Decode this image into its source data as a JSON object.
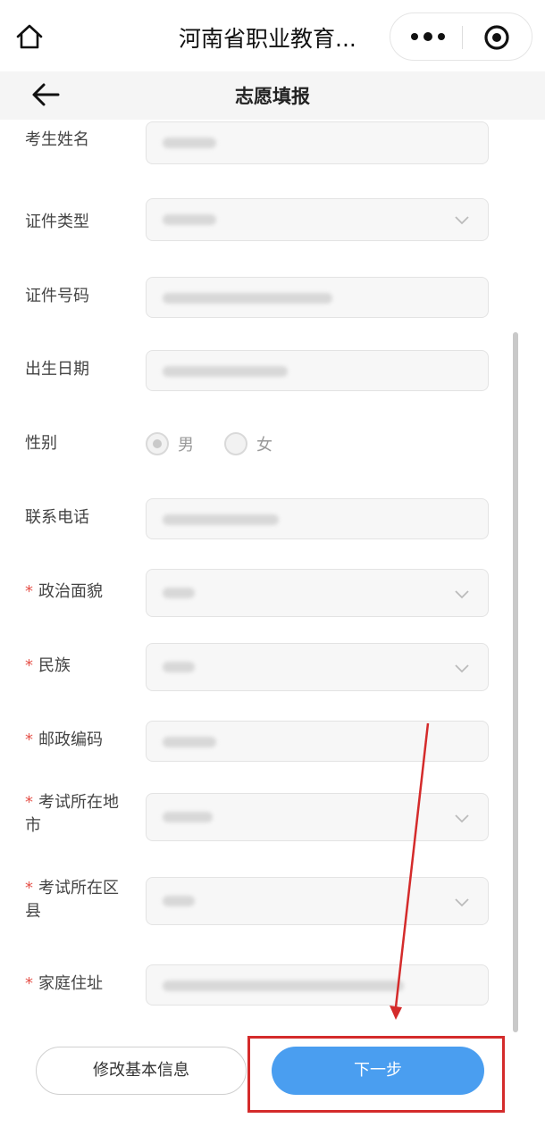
{
  "topbar": {
    "title": "河南省职业教育...",
    "more_icon": "more-dots-icon",
    "target_icon": "target-icon",
    "home_icon": "home-icon"
  },
  "navbar": {
    "title": "志愿填报",
    "back_icon": "back-arrow-icon"
  },
  "form": {
    "fields": [
      {
        "label": "考生姓名",
        "required": false,
        "type": "text"
      },
      {
        "label": "证件类型",
        "required": false,
        "type": "select"
      },
      {
        "label": "证件号码",
        "required": false,
        "type": "text"
      },
      {
        "label": "出生日期",
        "required": false,
        "type": "text"
      },
      {
        "label": "性别",
        "required": false,
        "type": "radio",
        "options": [
          "男",
          "女"
        ],
        "selected": "男"
      },
      {
        "label": "联系电话",
        "required": false,
        "type": "text"
      },
      {
        "label": "政治面貌",
        "required": true,
        "type": "select"
      },
      {
        "label": "民族",
        "required": true,
        "type": "select"
      },
      {
        "label": "邮政编码",
        "required": true,
        "type": "text"
      },
      {
        "label": "考试所在地市",
        "required": true,
        "type": "select"
      },
      {
        "label": "考试所在区县",
        "required": true,
        "type": "select"
      },
      {
        "label": "家庭住址",
        "required": true,
        "type": "text"
      }
    ],
    "required_mark": "*"
  },
  "buttons": {
    "edit_label": "修改基本信息",
    "next_label": "下一步"
  },
  "colors": {
    "primary": "#4a9ef0",
    "required": "#e5534b",
    "annotation": "#d42b2b"
  }
}
